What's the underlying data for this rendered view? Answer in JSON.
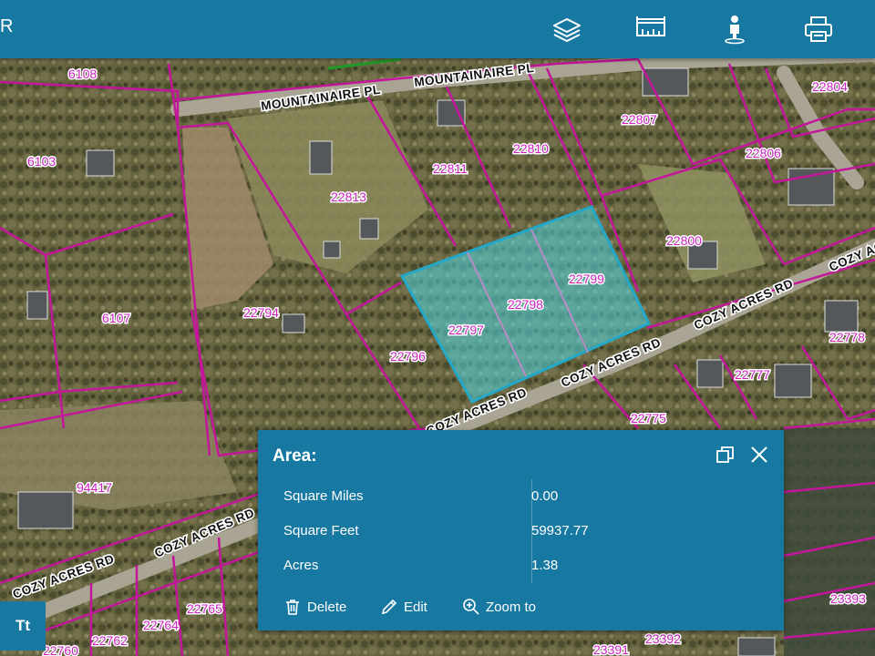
{
  "topbar": {
    "left_text": "R",
    "buttons": [
      {
        "name": "layers-icon"
      },
      {
        "name": "measure-icon"
      },
      {
        "name": "street-view-icon"
      },
      {
        "name": "print-icon"
      }
    ]
  },
  "map": {
    "parcel_labels": [
      "6108",
      "6103",
      "6107",
      "22804",
      "22807",
      "22810",
      "22811",
      "22806",
      "22813",
      "22800",
      "22794",
      "22799",
      "22798",
      "22797",
      "22796",
      "22778",
      "22777",
      "22775",
      "94417",
      "22765",
      "22764",
      "22762",
      "22760",
      "23393",
      "23392",
      "23391"
    ],
    "road_labels": [
      "MOUNTAINAIRE PL",
      "MOUNTAINAIRE PL",
      "COZY ACRES RD",
      "COZY ACRES RD",
      "COZY ACRES RD",
      "COZY ACRES RD",
      "COZY ACRES RD",
      "COZY ACRES RD"
    ],
    "colors": {
      "parcel_line": "#c4169a",
      "selection_fill": "#4fd6e0",
      "selection_stroke": "#23a8c8"
    }
  },
  "panel": {
    "title": "Area:",
    "rows": [
      {
        "label": "Square Miles",
        "value": "0.00"
      },
      {
        "label": "Square Feet",
        "value": "59937.77"
      },
      {
        "label": "Acres",
        "value": "1.38"
      }
    ],
    "actions": {
      "delete": "Delete",
      "edit": "Edit",
      "zoom": "Zoom to"
    }
  },
  "text_tool": {
    "label": "Tt"
  },
  "accent_color": "#1779a1"
}
